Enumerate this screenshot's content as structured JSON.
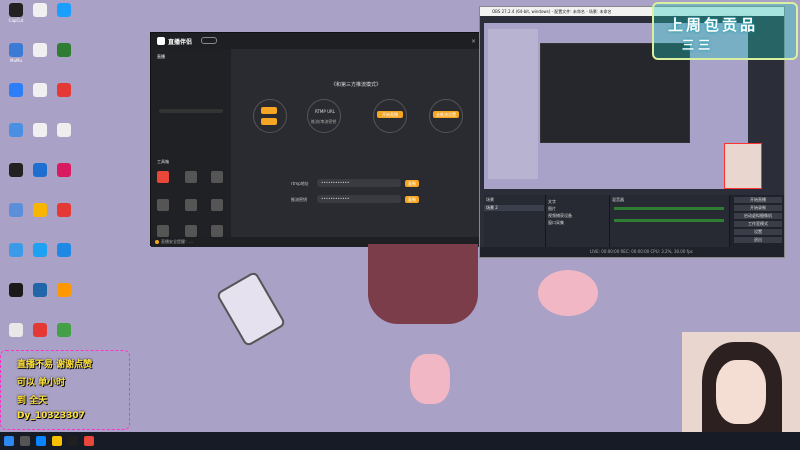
{
  "desktop": {
    "icons": [
      {
        "label": "CapCut",
        "color": "#222222"
      },
      {
        "label": "MuMu",
        "color": "#3a7bd5"
      },
      {
        "label": "",
        "color": "#2d7ff9"
      },
      {
        "label": "",
        "color": "#4a90e2"
      },
      {
        "label": "",
        "color": "#222222"
      },
      {
        "label": "",
        "color": "#5b8fd9"
      },
      {
        "label": "",
        "color": "#3c9be8"
      },
      {
        "label": "",
        "color": "#1a1a1a"
      },
      {
        "label": "",
        "color": "#e8e8e8"
      },
      {
        "label": "",
        "color": "#f0f0f0"
      },
      {
        "label": "",
        "color": "#f0f0f0"
      },
      {
        "label": "",
        "color": "#f0f0f0"
      },
      {
        "label": "",
        "color": "#f0f0f0"
      },
      {
        "label": "",
        "color": "#1f6fd1"
      },
      {
        "label": "",
        "color": "#f7b500"
      },
      {
        "label": "",
        "color": "#1da1f2"
      },
      {
        "label": "",
        "color": "#2266aa"
      },
      {
        "label": "",
        "color": "#e53935"
      },
      {
        "label": "",
        "color": "#1a9fff"
      },
      {
        "label": "",
        "color": "#2e7d32"
      },
      {
        "label": "",
        "color": "#e53935"
      },
      {
        "label": "",
        "color": "#eeeeee"
      },
      {
        "label": "",
        "color": "#d81b60"
      },
      {
        "label": "",
        "color": "#e53935"
      },
      {
        "label": "",
        "color": "#1e88e5"
      },
      {
        "label": "",
        "color": "#ff9800"
      },
      {
        "label": "",
        "color": "#43a047"
      }
    ]
  },
  "live_studio": {
    "brand": "直播伴侣",
    "nav_items": [
      "直播",
      "",
      ""
    ],
    "heading": "《和第三方推流模式》",
    "step1_btn": "",
    "step2_label": "RTMP URL",
    "step2_sub": "推流/串流密钥",
    "step3_btn": "开始直播",
    "step4_btn": "去推流设置",
    "rtmp_label": "rtmp地址",
    "rtmp_value": "••••••••••••",
    "key_label": "推流密钥",
    "key_value": "••••••••••••",
    "copy_btn": "复制",
    "copy_btn2": "复制",
    "tools_label": "工具箱",
    "start_btn": "开始直播",
    "notice": "直播安全提醒：...",
    "close_label": "关闭"
  },
  "obs": {
    "title": "OBS 27.2.4 (64-bit, windows) - 配置文件: 未命名 - 场景: 未命名",
    "scene_label": "场景",
    "scene_item": "场景 2",
    "source_items": [
      "文字",
      "图片",
      "视频捕获设备",
      "窗口采集"
    ],
    "mixer_label": "混音器",
    "controls": [
      "开始直播",
      "开始录制",
      "启动虚拟摄像机",
      "工作室模式",
      "设置",
      "退出"
    ],
    "status": "LIVE: 00:00:00  REC: 00:00:00  CPU: 3.2%, 30.00 fps"
  },
  "overlay": {
    "line1": "直播不易 谢谢点赞",
    "line2": "可以 单小时",
    "line3": "到 全天",
    "line4": "Dy_10323307"
  },
  "banner": {
    "text_top": "上周包贡品",
    "text_bottom": "三 三"
  },
  "taskbar": {
    "icons": [
      "windows-start",
      "search",
      "taskview",
      "edge",
      "explorer",
      "store",
      "obs"
    ]
  }
}
